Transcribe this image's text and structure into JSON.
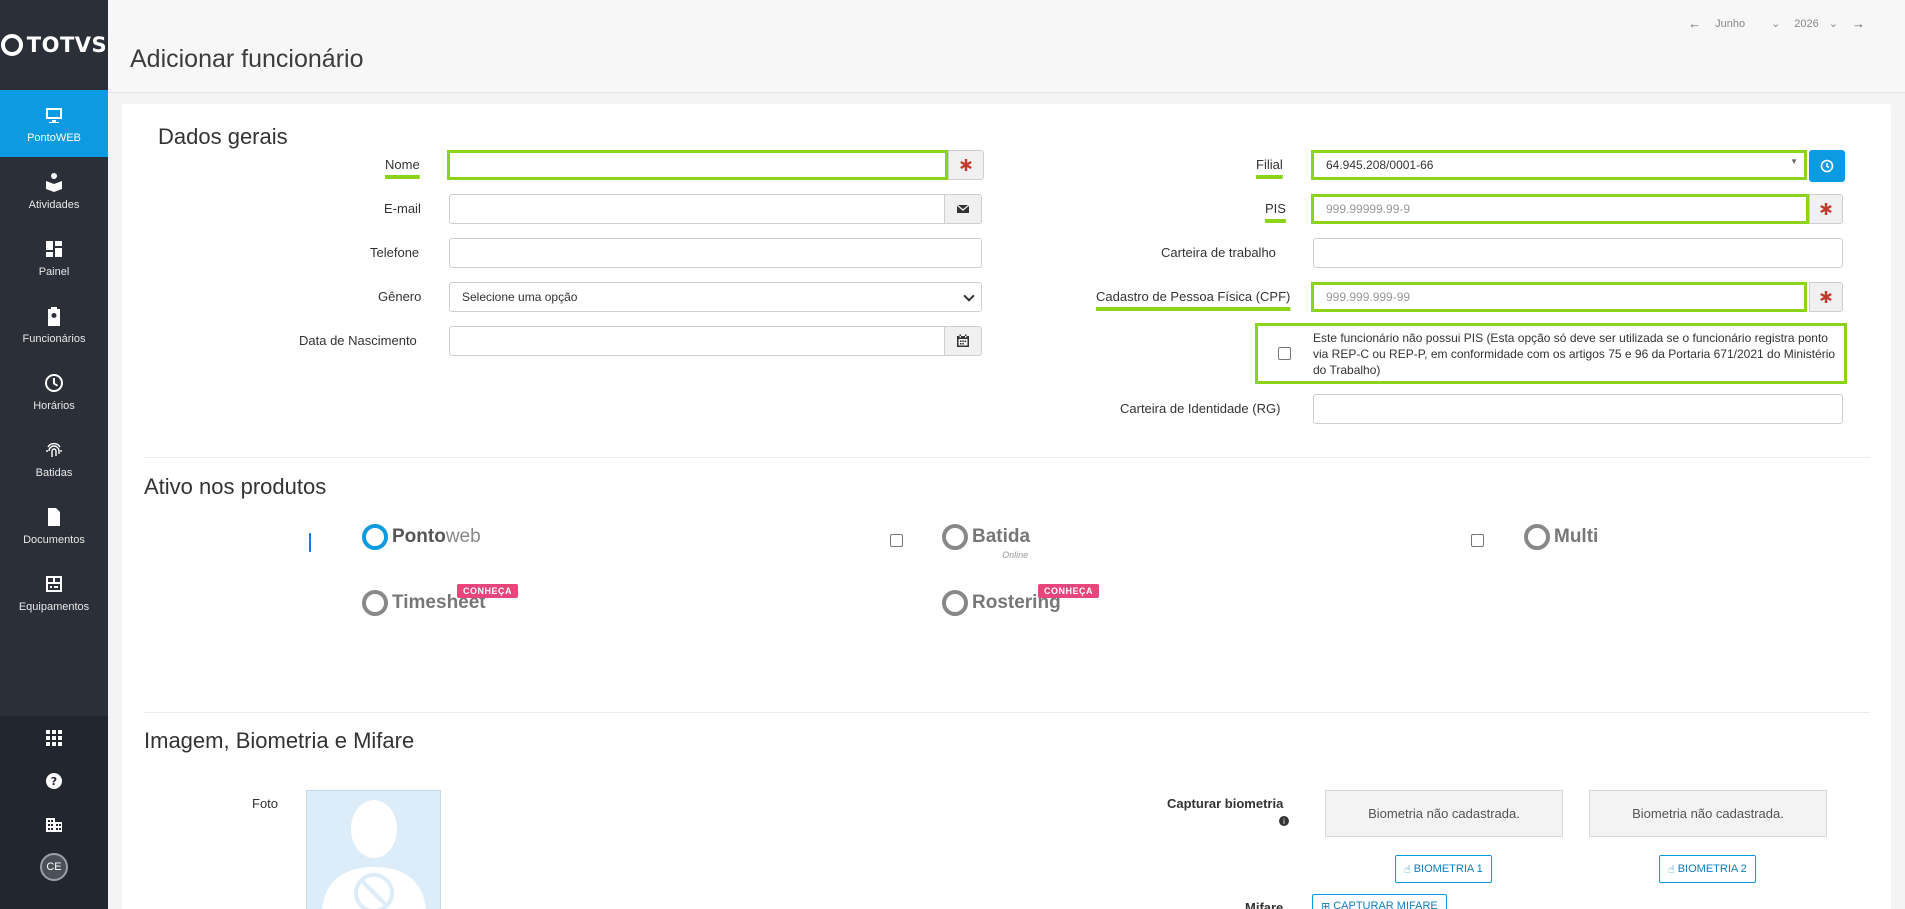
{
  "app": {
    "brand": "TOTVS"
  },
  "sidebar": {
    "items": [
      {
        "label": "PontoWEB",
        "icon": "monitor-icon",
        "active": true
      },
      {
        "label": "Atividades",
        "icon": "book-reader-icon"
      },
      {
        "label": "Painel",
        "icon": "dashboard-icon"
      },
      {
        "label": "Funcionários",
        "icon": "clipboard-user-icon"
      },
      {
        "label": "Horários",
        "icon": "clock-icon"
      },
      {
        "label": "Batidas",
        "icon": "fingerprint-icon"
      },
      {
        "label": "Documentos",
        "icon": "document-icon"
      },
      {
        "label": "Equipamentos",
        "icon": "equipment-icon"
      }
    ],
    "bottom": {
      "apps_icon": "grid-icon",
      "help_icon": "help-icon",
      "company_icon": "building-icon",
      "avatar": "CE"
    }
  },
  "header": {
    "title": "Adicionar funcionário",
    "period": {
      "month": "Junho",
      "year": "2026"
    }
  },
  "dados_gerais": {
    "title": "Dados gerais",
    "nome": {
      "label": "Nome",
      "value": ""
    },
    "email": {
      "label": "E-mail",
      "value": ""
    },
    "telefone": {
      "label": "Telefone",
      "value": ""
    },
    "genero": {
      "label": "Gênero",
      "value": "Selecione uma opção"
    },
    "nascimento": {
      "label": "Data de Nascimento",
      "value": ""
    },
    "filial": {
      "label": "Filial",
      "value": "64.945.208/0001-66"
    },
    "pis": {
      "label": "PIS",
      "placeholder": "999.99999.99-9"
    },
    "carteira_trabalho": {
      "label": "Carteira de trabalho",
      "value": ""
    },
    "cpf": {
      "label": "Cadastro de Pessoa Física (CPF)",
      "placeholder": "999.999.999-99"
    },
    "sem_pis": {
      "text": "Este funcionário não possui PIS (Esta opção só deve ser utilizada se o funcionário registra ponto via REP-C ou REP-P, em conformidade com os artigos 75 e 96 da Portaria 671/2021 do Ministério do Trabalho)",
      "checked": false
    },
    "rg": {
      "label": "Carteira de Identidade (RG)",
      "value": ""
    }
  },
  "produtos": {
    "title": "Ativo nos produtos",
    "items": [
      {
        "name_a": "Ponto",
        "name_b": "web",
        "checked": true
      },
      {
        "name_a": "Batida",
        "sub": "Online",
        "checked": false
      },
      {
        "name_a": "Multi",
        "checked": false
      },
      {
        "name_a": "Timesheet",
        "badge": "CONHEÇA"
      },
      {
        "name_a": "Rostering",
        "badge": "CONHEÇA"
      }
    ]
  },
  "imagem": {
    "title": "Imagem, Biometria e Mifare",
    "foto_label": "Foto",
    "biometria_label": "Capturar biometria",
    "bio1_status": "Biometria não cadastrada.",
    "bio2_status": "Biometria não cadastrada.",
    "bio1_button": "BIOMETRIA 1",
    "bio2_button": "BIOMETRIA 2",
    "mifare_label": "Mifare",
    "mifare_button": "CAPTURAR MIFARE"
  },
  "colors": {
    "accent": "#0c9ae0",
    "required_highlight": "#8cd31b",
    "sidebar_bg": "#2a2f38",
    "badge": "#e8457a"
  }
}
